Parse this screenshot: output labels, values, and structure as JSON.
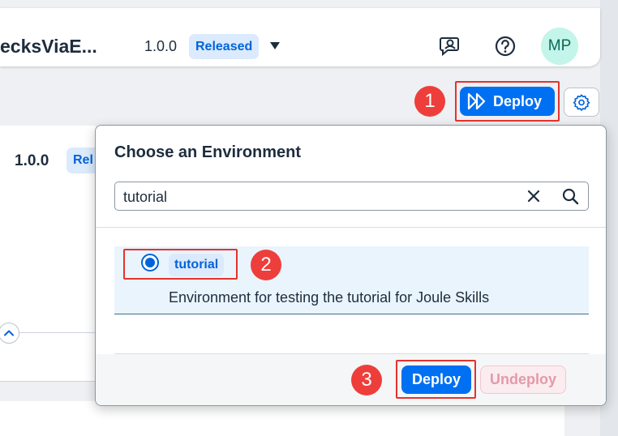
{
  "header": {
    "app_title": "ecksViaE...",
    "version": "1.0.0",
    "status_badge": "Released",
    "avatar_initials": "MP"
  },
  "toolbar": {
    "deploy_label": "Deploy"
  },
  "background": {
    "version": "1.0.0",
    "status_badge": "Rel"
  },
  "popover": {
    "title": "Choose an Environment",
    "search_value": "tutorial",
    "environments": [
      {
        "name": "tutorial",
        "description": "Environment for testing the tutorial for Joule Skills",
        "selected": true
      }
    ],
    "deploy_label": "Deploy",
    "undeploy_label": "Undeploy"
  },
  "annotations": [
    "1",
    "2",
    "3"
  ],
  "colors": {
    "accent": "#0070f2",
    "callout": "#ee3e3b",
    "badge_bg": "#dbeafc",
    "selected_row": "#eaf4fd"
  },
  "icons": [
    "chat-icon",
    "help-icon",
    "deploy-icon",
    "settings-icon",
    "clear-icon",
    "search-icon",
    "chevron-up-icon"
  ]
}
